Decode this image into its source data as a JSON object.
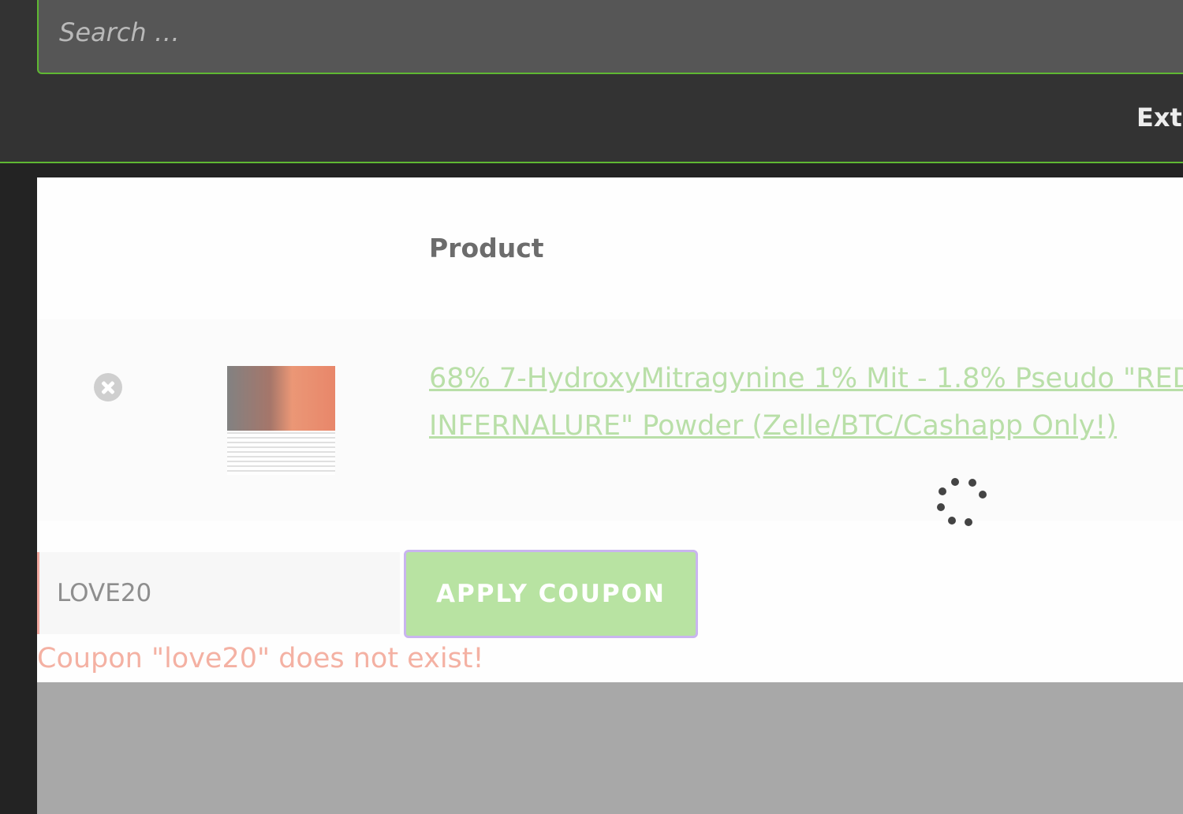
{
  "header": {
    "search_placeholder": "Search …",
    "nav_partial_label": "Extr"
  },
  "cart": {
    "column_product": "Product",
    "item": {
      "title_line1": "68% 7-HydroxyMitragynine 1% Mit - 1.8% Pseudo \"RED",
      "title_line2": "INFERNALURE\" Powder (Zelle/BTC/Cashapp Only!)"
    },
    "coupon": {
      "value": "LOVE20",
      "apply_label": "APPLY COUPON",
      "error_message": "Coupon \"love20\" does not exist!"
    }
  },
  "colors": {
    "accent_green": "#5fb833",
    "error_red": "#f4b1a3"
  },
  "icons": {
    "remove": "close-circle-icon",
    "loading": "spinner-icon"
  }
}
